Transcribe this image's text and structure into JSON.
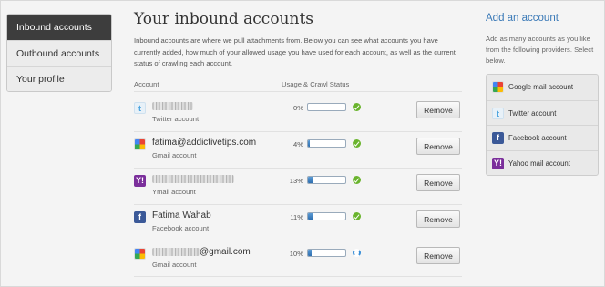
{
  "sidebar": {
    "items": [
      {
        "label": "Inbound accounts",
        "active": true
      },
      {
        "label": "Outbound accounts",
        "active": false
      },
      {
        "label": "Your profile",
        "active": false
      }
    ]
  },
  "main": {
    "title": "Your inbound accounts",
    "description": "Inbound accounts are where we pull attachments from. Below you can see what accounts you have currently added, how much of your allowed usage you have used for each account, as well as the current status of crawling each account.",
    "columns": {
      "account": "Account",
      "usage": "Usage & Crawl Status"
    },
    "remove_label": "Remove",
    "accounts": [
      {
        "icon": "twitter-icon",
        "name": "",
        "name_blurred": true,
        "suffix": "",
        "type": "Twitter account",
        "usage_pct": "0%",
        "usage_value": 0,
        "status": "ok"
      },
      {
        "icon": "gmail-icon",
        "name": "fatima@addictivetips.com",
        "name_blurred": false,
        "suffix": "",
        "type": "Gmail account",
        "usage_pct": "4%",
        "usage_value": 4,
        "status": "ok"
      },
      {
        "icon": "yahoo-icon",
        "name": "",
        "name_blurred": true,
        "suffix": "",
        "type": "Ymail account",
        "usage_pct": "13%",
        "usage_value": 13,
        "status": "ok"
      },
      {
        "icon": "facebook-icon",
        "name": "Fatima Wahab",
        "name_blurred": false,
        "suffix": "",
        "type": "Facebook account",
        "usage_pct": "11%",
        "usage_value": 11,
        "status": "ok"
      },
      {
        "icon": "gmail-icon",
        "name": "",
        "name_blurred": true,
        "suffix": "@gmail.com",
        "type": "Gmail account",
        "usage_pct": "10%",
        "usage_value": 10,
        "status": "syncing"
      }
    ]
  },
  "add_panel": {
    "title": "Add an account",
    "description": "Add as many accounts as you like from the following providers. Select below.",
    "providers": [
      {
        "icon": "gmail-icon",
        "label": "Google mail account"
      },
      {
        "icon": "twitter-icon",
        "label": "Twitter account"
      },
      {
        "icon": "facebook-icon",
        "label": "Facebook account"
      },
      {
        "icon": "yahoo-icon",
        "label": "Yahoo mail account"
      }
    ]
  }
}
